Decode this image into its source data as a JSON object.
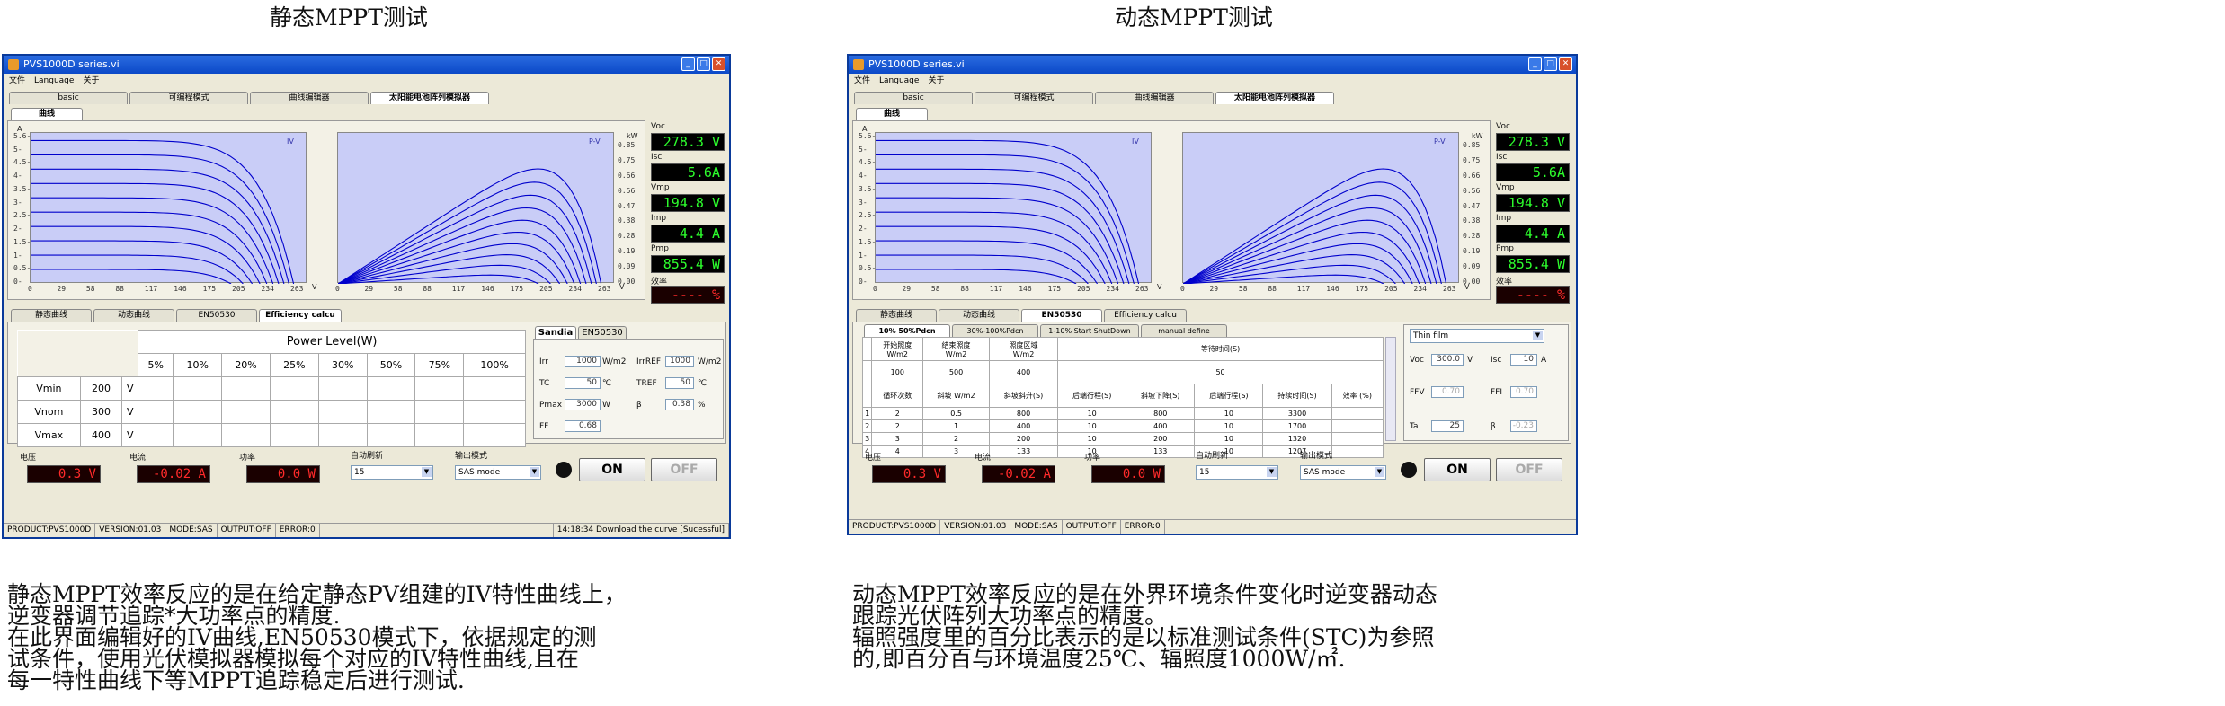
{
  "captions": {
    "left": "静态MPPT测试",
    "right": "动态MPPT测试"
  },
  "paragraphs": {
    "left": "静态MPPT效率反应的是在给定静态PV组建的IV特性曲线上，\n逆变器调节追踪*大功率点的精度.\n在此界面编辑好的IV曲线,EN50530模式下，依据规定的测\n试条件，使用光伏模拟器模拟每个对应的IV特性曲线,且在\n每一特性曲线下等MPPT追踪稳定后进行测试.",
    "right": "动态MPPT效率反应的是在外界环境条件变化时逆变器动态\n跟踪光伏阵列大功率点的精度。\n辐照强度里的百分比表示的是以标准测试条件(STC)为参照\n的,即百分百与环境温度25℃、辐照度1000W/㎡."
  },
  "window": {
    "title": "PVS1000D series.vi",
    "menu": [
      "文件",
      "Language",
      "关于"
    ],
    "top_tabs": [
      "basic",
      "可编程模式",
      "曲线编辑器",
      "太阳能电池阵列模拟器"
    ],
    "sub_tab": "曲线",
    "iv_plot": {
      "label": "IV",
      "y_axis": "A",
      "x_axis": "V",
      "y_ticks": [
        "5.6-",
        "5-",
        "4.5-",
        "4-",
        "3.5-",
        "3-",
        "2.5-",
        "2-",
        "1.5-",
        "1-",
        "0.5-",
        "0-"
      ],
      "x_ticks": [
        "0",
        "29",
        "58",
        "88",
        "117",
        "146",
        "175",
        "205",
        "234",
        "263"
      ]
    },
    "pv_plot": {
      "label": "P-V",
      "y_axis": "kW",
      "x_axis": "V",
      "y_ticks": [
        "0.85",
        "0.75",
        "0.66",
        "0.56",
        "0.47",
        "0.38",
        "0.28",
        "0.19",
        "0.09",
        "0.00"
      ],
      "x_ticks": [
        "0",
        "29",
        "58",
        "88",
        "117",
        "146",
        "175",
        "205",
        "234",
        "263"
      ]
    },
    "readouts": [
      {
        "label": "Voc",
        "value": "278.3 V"
      },
      {
        "label": "Isc",
        "value": "5.6A"
      },
      {
        "label": "Vmp",
        "value": "194.8 V"
      },
      {
        "label": "Imp",
        "value": "4.4 A"
      },
      {
        "label": "Pmp",
        "value": "855.4 W"
      },
      {
        "label": "效率",
        "value": "---- %"
      }
    ],
    "bottom": {
      "labels": [
        "电压",
        "电流",
        "功率",
        "自动刷新",
        "输出模式"
      ],
      "voltage": "0.3 V",
      "current": "-0.02 A",
      "power": "0.0 W",
      "refresh": "15",
      "mode": "SAS mode",
      "on": "ON",
      "off": "OFF"
    },
    "status": [
      "PRODUCT:PVS1000D",
      "VERSION:01.03",
      "MODE:SAS",
      "OUTPUT:OFF",
      "ERROR:0"
    ]
  },
  "left_window": {
    "eff_tabs": [
      "静态曲线",
      "动态曲线",
      "EN50530",
      "Efficiency calcu"
    ],
    "power_level_title": "Power Level(W)",
    "percent_cols": [
      "5%",
      "10%",
      "20%",
      "25%",
      "30%",
      "50%",
      "75%",
      "100%"
    ],
    "rows": [
      {
        "name": "Vmin",
        "val": "200",
        "unit": "V"
      },
      {
        "name": "Vnom",
        "val": "300",
        "unit": "V"
      },
      {
        "name": "Vmax",
        "val": "400",
        "unit": "V"
      }
    ],
    "right_tabs": [
      "Sandia",
      "EN50530"
    ],
    "params": {
      "irr_label": "Irr",
      "irr_val": "1000",
      "irr_unit": "W/m2",
      "irref_label": "IrrREF",
      "irref_val": "1000",
      "irref_unit": "W/m2",
      "tc_label": "TC",
      "tc_val": "50",
      "tc_unit": "℃",
      "tref_label": "TREF",
      "tref_val": "50",
      "tref_unit": "℃",
      "pmax_label": "Pmax",
      "pmax_val": "3000",
      "pmax_unit": "W",
      "beta_label": "β",
      "beta_val": "0.38",
      "beta_unit": "%",
      "ff_label": "FF",
      "ff_val": "0.68"
    },
    "status_msg": "14:18:34 Download the curve [Sucessful]"
  },
  "right_window": {
    "eff_tabs": [
      "静态曲线",
      "动态曲线",
      "EN50530",
      "Efficiency calcu"
    ],
    "sub_tabs": [
      "10% 50%Pdcn",
      "30%-100%Pdcn",
      "1-10% Start ShutDown",
      "manual define"
    ],
    "head1": [
      "开始照度\nW/m2",
      "结束照度\nW/m2",
      "照度区域\nW/m2",
      "等待时间(S)"
    ],
    "head1_vals": [
      "100",
      "500",
      "400",
      "50"
    ],
    "head2": [
      "循环次数",
      "斜坡 W/m2",
      "斜坡斜升(S)",
      "后端行程(S)",
      "斜坡下降(S)",
      "后端行程(S)",
      "持续时间(S)",
      "效率 (%)"
    ],
    "rows": [
      [
        "1",
        "2",
        "0.5",
        "800",
        "10",
        "800",
        "10",
        "3300",
        ""
      ],
      [
        "2",
        "2",
        "1",
        "400",
        "10",
        "400",
        "10",
        "1700",
        ""
      ],
      [
        "3",
        "3",
        "2",
        "200",
        "10",
        "200",
        "10",
        "1320",
        ""
      ],
      [
        "4",
        "4",
        "3",
        "133",
        "10",
        "133",
        "10",
        "1207",
        ""
      ]
    ],
    "module": "Thin film",
    "params": {
      "voc_label": "Voc",
      "voc_val": "300.0",
      "voc_unit": "V",
      "isc_label": "Isc",
      "isc_val": "10",
      "isc_unit": "A",
      "ffv_label": "FFV",
      "ffv_val": "0.70",
      "ffi_label": "FFI",
      "ffi_val": "0.70",
      "ta_label": "Ta",
      "ta_val": "25",
      "beta_label": "β",
      "beta_val": "-0.23"
    }
  }
}
